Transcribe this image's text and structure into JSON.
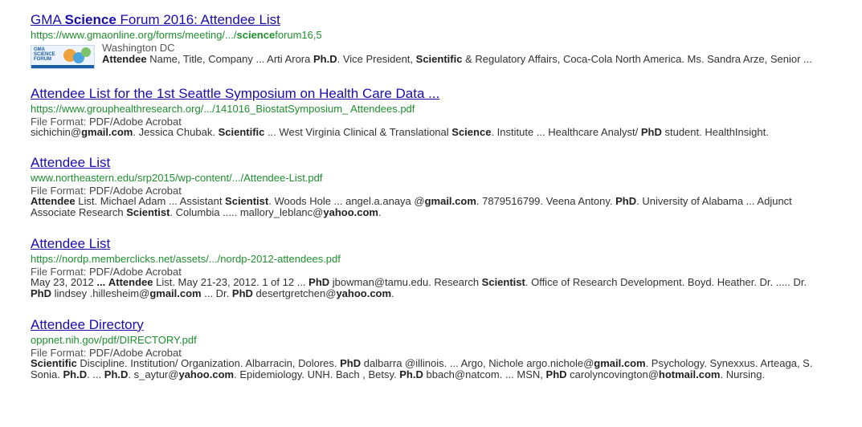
{
  "results": [
    {
      "title_parts": [
        {
          "t": "GMA ",
          "b": false
        },
        {
          "t": "Science",
          "b": true
        },
        {
          "t": " Forum 2016: Attendee List",
          "b": false
        }
      ],
      "url_parts": [
        {
          "t": "https://www.gmaonline.org/forms/meeting/.../",
          "b": false
        },
        {
          "t": "science",
          "b": true
        },
        {
          "t": "forum16,5",
          "b": false
        }
      ],
      "thumbnail_text": "GMA SCIENCE FORUM",
      "location": "Washington DC",
      "snippet": [
        {
          "t": "Attendee",
          "b": true
        },
        {
          "t": " Name, Title, Company ... Arti Arora ",
          "b": false
        },
        {
          "t": "Ph.D",
          "b": true
        },
        {
          "t": ". Vice President, ",
          "b": false
        },
        {
          "t": "Scientific",
          "b": true
        },
        {
          "t": " & Regulatory Affairs, Coca-Cola North America. Ms. Sandra Arze, Senior ...",
          "b": false
        }
      ]
    },
    {
      "title_parts": [
        {
          "t": "Attendee List for the 1st Seattle Symposium on Health Care Data ...",
          "b": false
        }
      ],
      "url_parts": [
        {
          "t": "https://www.grouphealthresearch.org/.../141016_BiostatSymposium_ Attendees.pdf",
          "b": false
        }
      ],
      "file_format_label": "File Format:",
      "file_format": "PDF/Adobe Acrobat",
      "snippet": [
        {
          "t": "sichichin@",
          "b": false
        },
        {
          "t": "gmail.com",
          "b": true
        },
        {
          "t": ". Jessica Chubak. ",
          "b": false
        },
        {
          "t": "Scientific",
          "b": true
        },
        {
          "t": " ... West Virginia Clinical & Translational ",
          "b": false
        },
        {
          "t": "Science",
          "b": true
        },
        {
          "t": ". Institute ... Healthcare Analyst/ ",
          "b": false
        },
        {
          "t": "PhD",
          "b": true
        },
        {
          "t": " student. HealthInsight.",
          "b": false
        }
      ]
    },
    {
      "title_parts": [
        {
          "t": "Attendee List",
          "b": false
        }
      ],
      "url_parts": [
        {
          "t": "www.northeastern.edu/srp2015/wp-content/.../Attendee-List.pdf",
          "b": false
        }
      ],
      "file_format_label": "File Format:",
      "file_format": "PDF/Adobe Acrobat",
      "snippet": [
        {
          "t": "Attendee",
          "b": true
        },
        {
          "t": " List. Michael Adam ... Assistant ",
          "b": false
        },
        {
          "t": "Scientist",
          "b": true
        },
        {
          "t": ". Woods Hole ... angel.a.anaya @",
          "b": false
        },
        {
          "t": "gmail.com",
          "b": true
        },
        {
          "t": ". 7879516799. Veena Antony. ",
          "b": false
        },
        {
          "t": "PhD",
          "b": true
        },
        {
          "t": ". University of Alabama ... Adjunct Associate Research ",
          "b": false
        },
        {
          "t": "Scientist",
          "b": true
        },
        {
          "t": ". Columbia ..... mallory_leblanc@",
          "b": false
        },
        {
          "t": "yahoo.com",
          "b": true
        },
        {
          "t": ".",
          "b": false
        }
      ]
    },
    {
      "title_parts": [
        {
          "t": "Attendee List",
          "b": false
        }
      ],
      "url_parts": [
        {
          "t": "https://nordp.memberclicks.net/assets/.../nordp-2012-attendees.pdf",
          "b": false
        }
      ],
      "file_format_label": "File Format:",
      "file_format": "PDF/Adobe Acrobat",
      "snippet": [
        {
          "t": "May 23, 2012 ",
          "b": false
        },
        {
          "t": "...",
          "b": true
        },
        {
          "t": " ",
          "b": false
        },
        {
          "t": "Attendee",
          "b": true
        },
        {
          "t": " List. May 21-23, 2012. 1 of 12 ... ",
          "b": false
        },
        {
          "t": "PhD",
          "b": true
        },
        {
          "t": " jbowman@tamu.edu. Research ",
          "b": false
        },
        {
          "t": "Scientist",
          "b": true
        },
        {
          "t": ". Office of Research Development. Boyd. Heather. Dr. ..... Dr. ",
          "b": false
        },
        {
          "t": "PhD",
          "b": true
        },
        {
          "t": " lindsey .hillesheim@",
          "b": false
        },
        {
          "t": "gmail.com",
          "b": true
        },
        {
          "t": " ... Dr. ",
          "b": false
        },
        {
          "t": "PhD",
          "b": true
        },
        {
          "t": " desertgretchen@",
          "b": false
        },
        {
          "t": "yahoo.com",
          "b": true
        },
        {
          "t": ".",
          "b": false
        }
      ]
    },
    {
      "title_parts": [
        {
          "t": "Attendee Directory",
          "b": false
        }
      ],
      "url_parts": [
        {
          "t": "oppnet.nih.gov/pdf/DIRECTORY.pdf",
          "b": false
        }
      ],
      "file_format_label": "File Format:",
      "file_format": "PDF/Adobe Acrobat",
      "snippet": [
        {
          "t": "Scientific",
          "b": true
        },
        {
          "t": " Discipline. Institution/ Organization. Albarracin, Dolores. ",
          "b": false
        },
        {
          "t": "PhD",
          "b": true
        },
        {
          "t": " dalbarra @illinois. ... Argo, Nichole argo.nichole@",
          "b": false
        },
        {
          "t": "gmail.com",
          "b": true
        },
        {
          "t": ". Psychology. Synexxus. Arteaga, S. Sonia. ",
          "b": false
        },
        {
          "t": "Ph.D",
          "b": true
        },
        {
          "t": ". ... ",
          "b": false
        },
        {
          "t": "Ph.D",
          "b": true
        },
        {
          "t": ". s_aytur@",
          "b": false
        },
        {
          "t": "yahoo.com",
          "b": true
        },
        {
          "t": ". Epidemiology. UNH. Bach , Betsy. ",
          "b": false
        },
        {
          "t": "Ph.D",
          "b": true
        },
        {
          "t": " bbach@natcom. ... MSN, ",
          "b": false
        },
        {
          "t": "PhD",
          "b": true
        },
        {
          "t": " carolyncovington@",
          "b": false
        },
        {
          "t": "hotmail.com",
          "b": true
        },
        {
          "t": ". Nursing.",
          "b": false
        }
      ]
    }
  ],
  "colors": {
    "title": "#1a0dab",
    "url": "#1e8f2d",
    "snippet": "#333333"
  }
}
